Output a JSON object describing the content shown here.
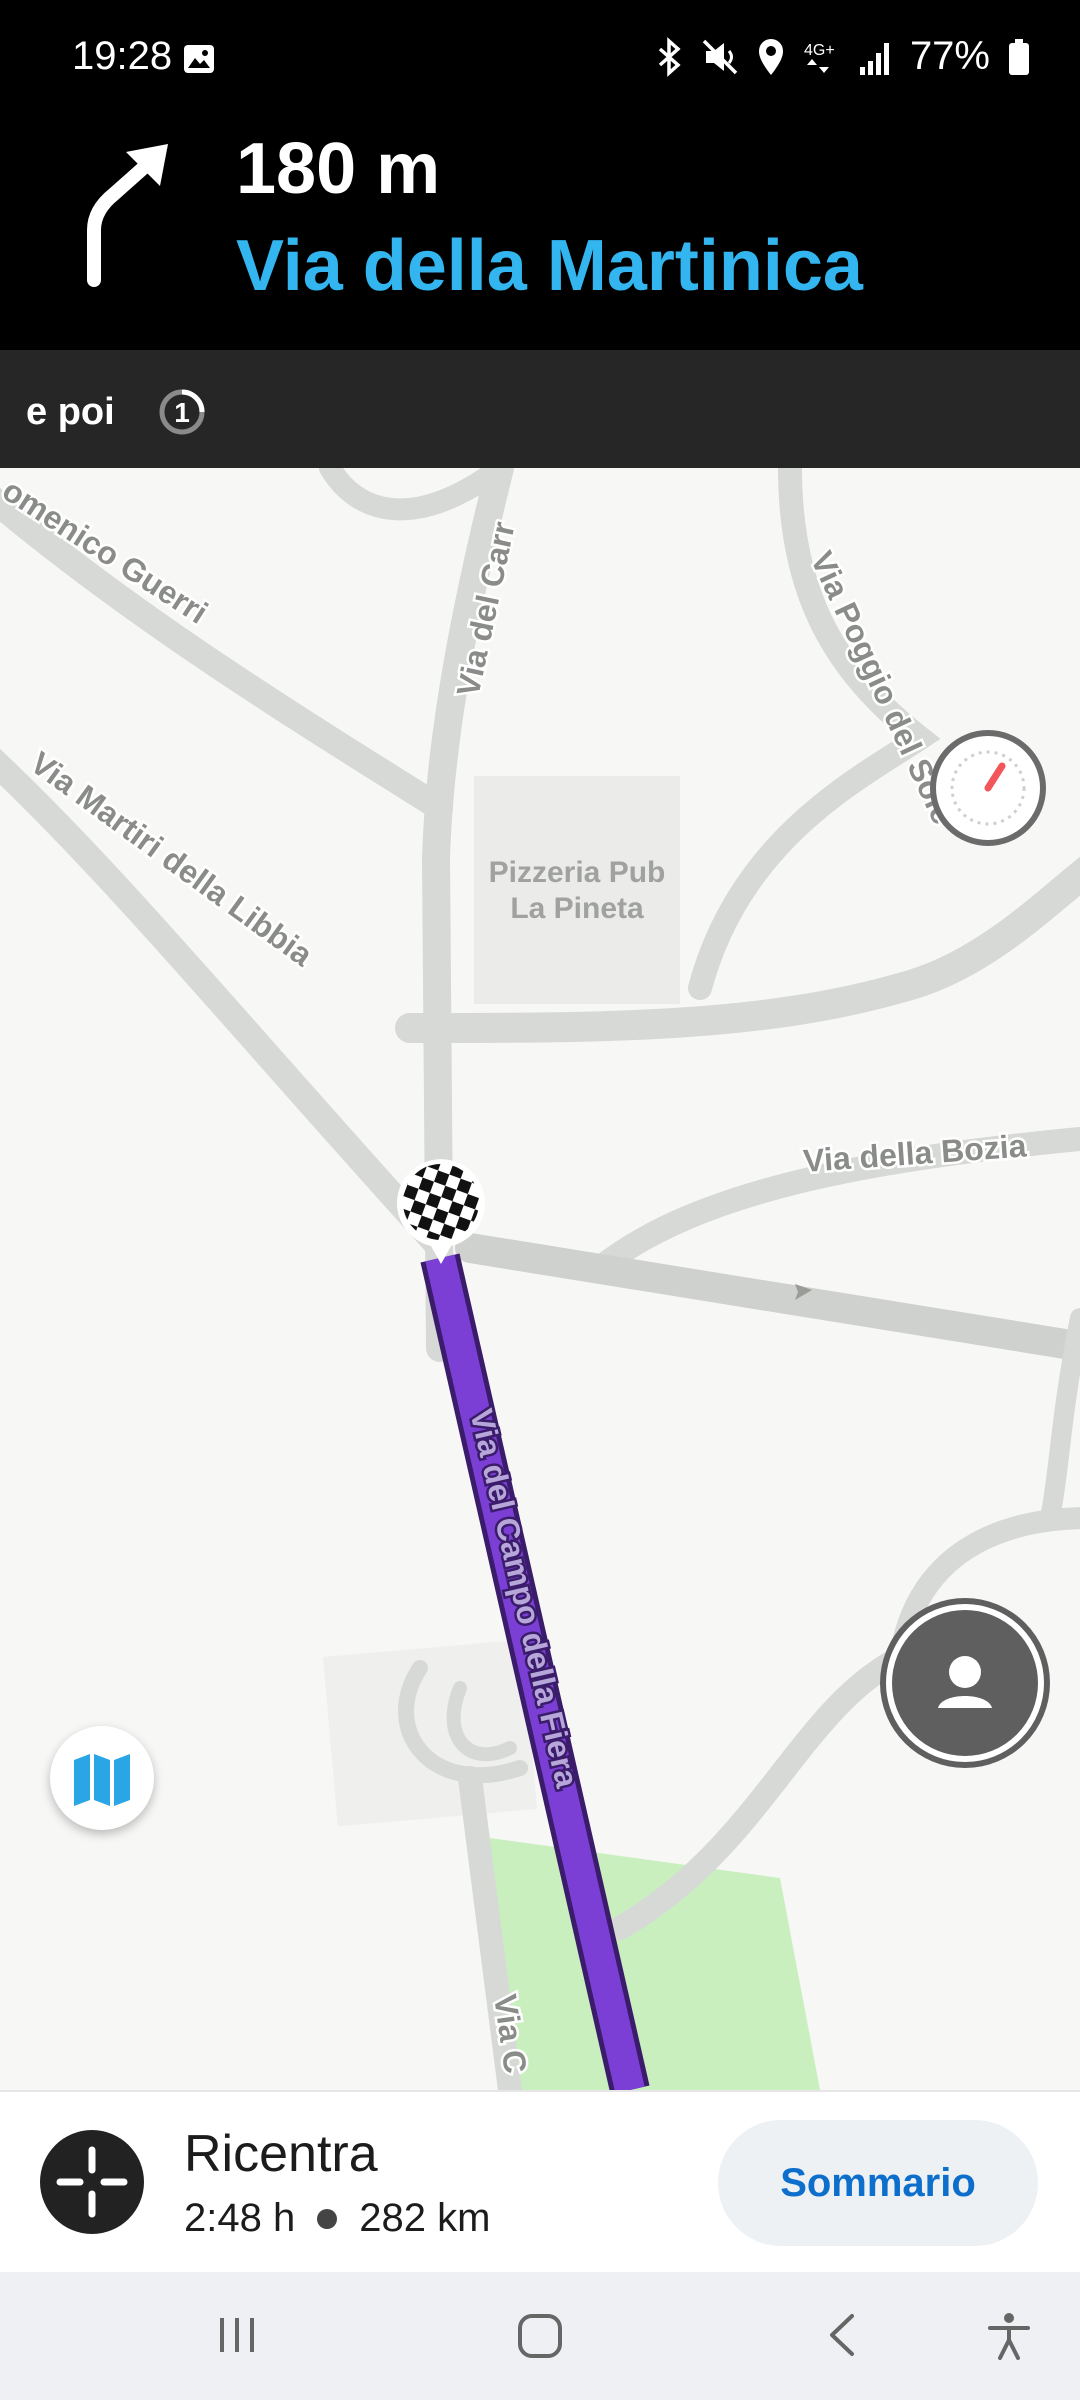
{
  "status_bar": {
    "time": "19:28",
    "battery": "77%",
    "network": "4G+",
    "icons": [
      "image-icon",
      "bluetooth-icon",
      "mute-icon",
      "location-icon",
      "network-icon",
      "signal-icon",
      "battery-icon"
    ]
  },
  "instruction": {
    "distance": "180 m",
    "street": "Via della Martinica",
    "maneuver": "turn-right-icon"
  },
  "then": {
    "label": "e poi",
    "exit_number": "1"
  },
  "map": {
    "street_labels": [
      "omenico Guerri",
      "Via del Carr",
      "Via Poggio del Sole",
      "Via Martiri della Libbia",
      "Via della Bozia",
      "Via del Campo della Fiera",
      "Via C"
    ],
    "poi": {
      "line1": "Pizzeria Pub",
      "line2": "La Pineta"
    },
    "route_color": "#7b3fd6"
  },
  "bottom_panel": {
    "recenter_label": "Ricentra",
    "duration": "2:48 h",
    "distance": "282 km",
    "summary_label": "Sommario"
  },
  "colors": {
    "street_blue": "#33b5f0",
    "summary_text": "#0d6fcb"
  }
}
